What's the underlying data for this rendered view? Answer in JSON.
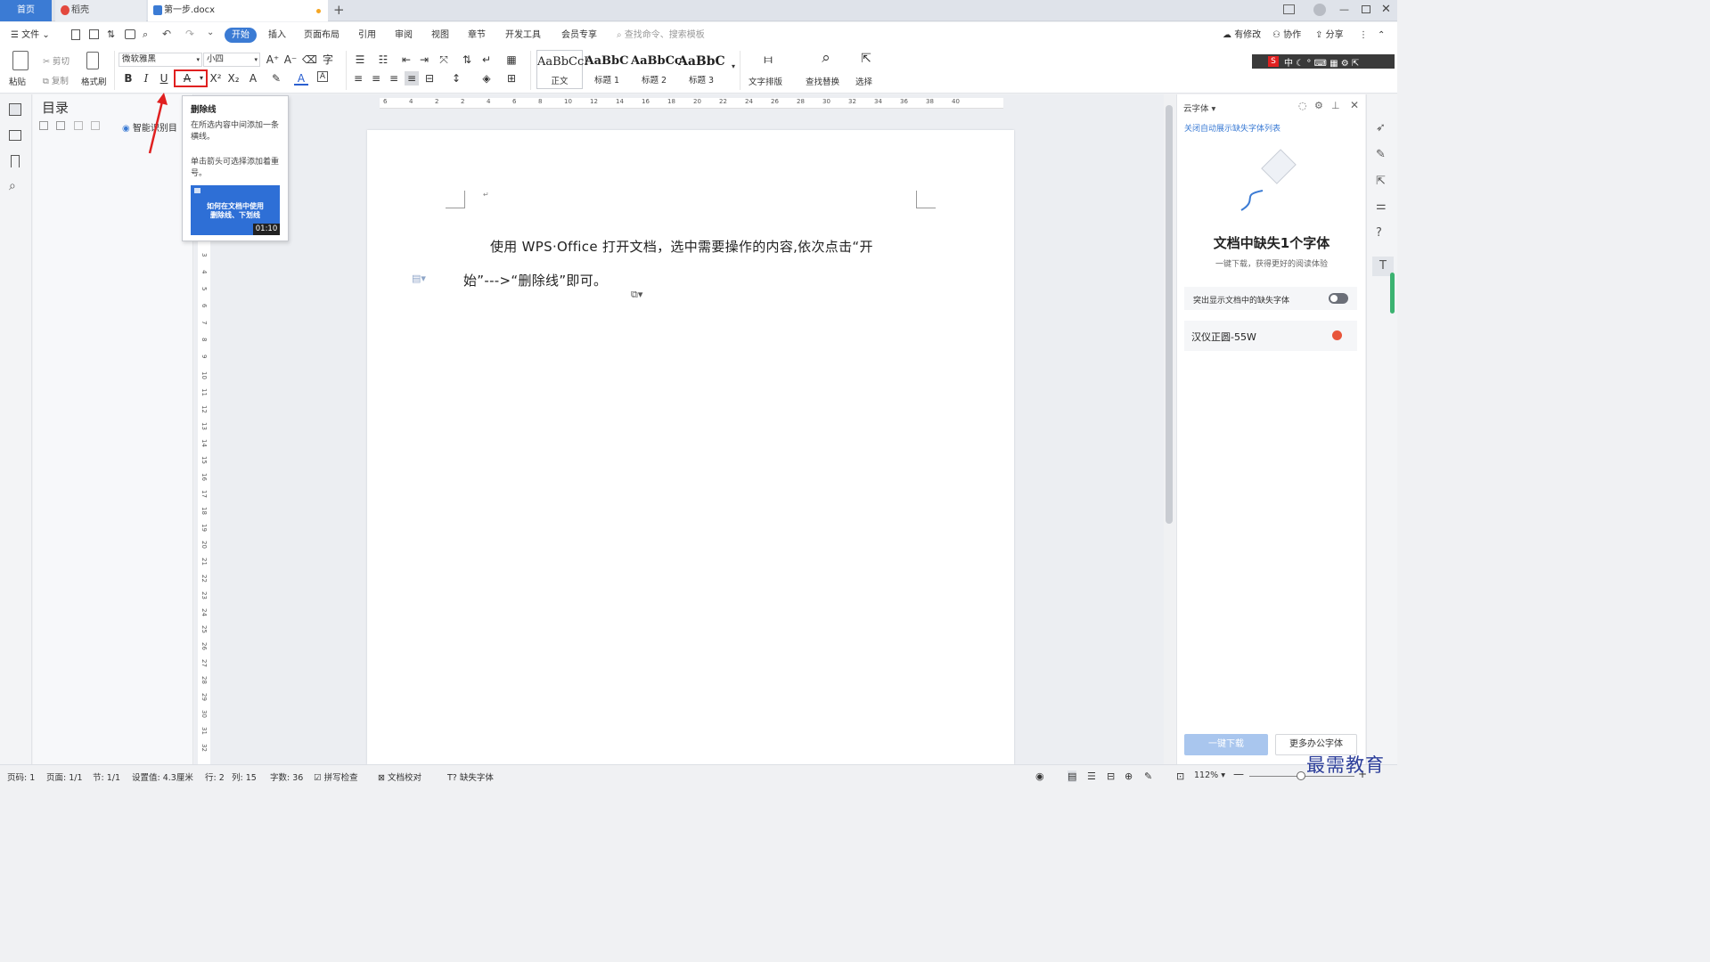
{
  "tabs": {
    "home": "首页",
    "daoke": "稻壳",
    "doc": "第一步.docx"
  },
  "menu": {
    "file": "文件",
    "items": [
      "开始",
      "插入",
      "页面布局",
      "引用",
      "审阅",
      "视图",
      "章节",
      "开发工具",
      "会员专享"
    ],
    "search_placeholder": "查找命令、搜索模板",
    "modified": "有修改",
    "collab": "协作",
    "share": "分享"
  },
  "ribbon": {
    "paste": "粘贴",
    "cut": "剪切",
    "copy": "复制",
    "format_painter": "格式刷",
    "font_name": "微软雅黑",
    "font_size": "小四",
    "styles": [
      {
        "sample": "AaBbCcI",
        "label": "正文"
      },
      {
        "sample": "AaBbC",
        "label": "标题 1"
      },
      {
        "sample": "AaBbCc",
        "label": "标题 2"
      },
      {
        "sample": "AaBbC",
        "label": "标题 3"
      }
    ],
    "text_layout": "文字排版",
    "find_replace": "查找替换",
    "select": "选择"
  },
  "toc": {
    "title": "目录",
    "smart": "智能识别目"
  },
  "tooltip": {
    "title": "删除线",
    "desc1": "在所选内容中间添加一条横线。",
    "desc2": "单击箭头可选择添加着重号。",
    "video_line1": "如何在文档中使用",
    "video_line2": "删除线、下划线",
    "duration": "01:10"
  },
  "document": {
    "line1": "使用 WPS·Office 打开文档，选中需要操作的内容,依次点击“开",
    "line2": "始”--->“删除线”即可。"
  },
  "ruler_marks": [
    "6",
    "4",
    "2",
    "2",
    "4",
    "6",
    "8",
    "10",
    "12",
    "14",
    "16",
    "18",
    "20",
    "22",
    "24",
    "26",
    "28",
    "30",
    "32",
    "34",
    "36",
    "38",
    "40"
  ],
  "vruler_marks": [
    "3",
    "4",
    "5",
    "6",
    "7",
    "8",
    "9",
    "10",
    "11",
    "12",
    "13",
    "14",
    "15",
    "16",
    "17",
    "18",
    "19",
    "20",
    "21",
    "22",
    "23",
    "24",
    "25",
    "26",
    "27",
    "28",
    "29",
    "30",
    "31",
    "32"
  ],
  "rightpanel": {
    "header": "云字体",
    "link": "关闭自动展示缺失字体列表",
    "title": "文档中缺失1个字体",
    "subtitle": "一键下载，获得更好的阅读体验",
    "toggle_label": "突出显示文档中的缺失字体",
    "font_item": "汉仪正圆-55W",
    "download_btn": "一键下载",
    "more_btn": "更多办公字体"
  },
  "status": {
    "page": "页码: 1",
    "pages": "页面: 1/1",
    "section": "节: 1/1",
    "setting": "设置值: 4.3厘米",
    "row": "行: 2",
    "col": "列: 15",
    "words": "字数: 36",
    "spell": "拼写检查",
    "proof": "文档校对",
    "missing_font": "缺失字体",
    "zoom": "112%"
  },
  "watermark": "最需教育",
  "colors": {
    "accent": "#3b7bd4",
    "highlight_red": "#e02020"
  }
}
